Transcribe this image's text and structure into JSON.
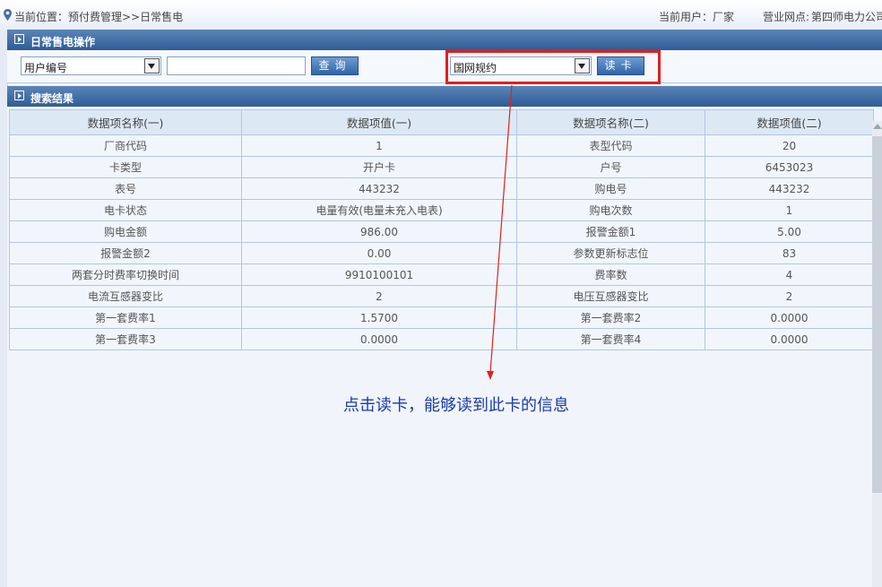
{
  "topbar": {
    "location": "当前位置：预付费管理>>日常售电",
    "user_label": "当前用户：",
    "user_value": "厂家",
    "site_label": "营业网点:",
    "site_value": "第四师电力公司"
  },
  "operation_panel": {
    "title": "日常售电操作",
    "field_select": "用户编号",
    "search_value": "",
    "query_button": "查询",
    "protocol_select": "国网规约",
    "read_card_button": "读卡"
  },
  "results_panel": {
    "title": "搜索结果",
    "headers": [
      "数据项名称(一)",
      "数据项值(一)",
      "数据项名称(二)",
      "数据项值(二)"
    ],
    "rows": [
      [
        "厂商代码",
        "1",
        "表型代码",
        "20"
      ],
      [
        "卡类型",
        "开户卡",
        "户号",
        "6453023"
      ],
      [
        "表号",
        "443232",
        "购电号",
        "443232"
      ],
      [
        "电卡状态",
        "电量有效(电量未充入电表)",
        "购电次数",
        "1"
      ],
      [
        "购电金额",
        "986.00",
        "报警金额1",
        "5.00"
      ],
      [
        "报警金额2",
        "0.00",
        "参数更新标志位",
        "83"
      ],
      [
        "两套分时费率切换时间",
        "9910100101",
        "费率数",
        "4"
      ],
      [
        "电流互感器变比",
        "2",
        "电压互感器变比",
        "2"
      ],
      [
        "第一套费率1",
        "1.5700",
        "第一套费率2",
        "0.0000"
      ],
      [
        "第一套费率3",
        "0.0000",
        "第一套费率4",
        "0.0000"
      ]
    ]
  },
  "annotation": {
    "text": "点击读卡，能够读到此卡的信息",
    "color": "#1a3aa8",
    "box_color": "#e0201c"
  }
}
